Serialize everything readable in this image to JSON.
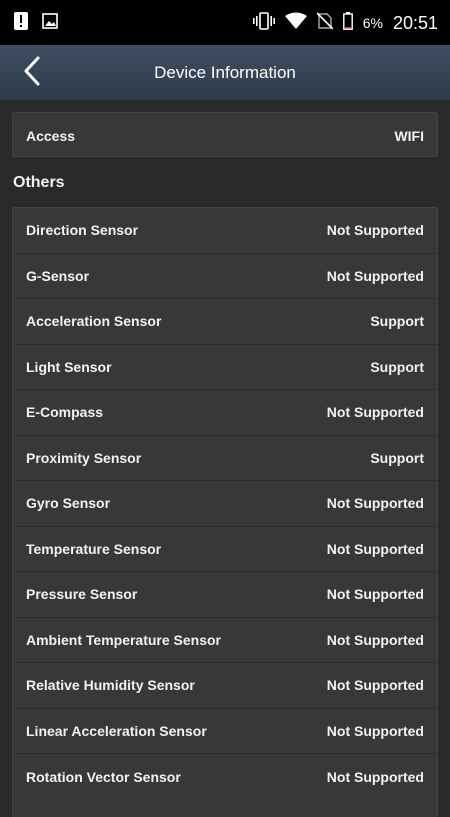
{
  "statusbar": {
    "time": "20:51",
    "battery_percent": "6%",
    "icons": [
      "alert-icon",
      "image-icon",
      "vibrate-icon",
      "wifi-icon",
      "no-sim-icon",
      "battery-icon"
    ]
  },
  "appbar": {
    "title": "Device Information",
    "back_icon": "chevron-left-icon"
  },
  "access": {
    "label": "Access",
    "value": "WIFI"
  },
  "others": {
    "title": "Others",
    "items": [
      {
        "label": "Direction Sensor",
        "value": "Not Supported"
      },
      {
        "label": "G-Sensor",
        "value": "Not Supported"
      },
      {
        "label": "Acceleration Sensor",
        "value": "Support"
      },
      {
        "label": "Light Sensor",
        "value": "Support"
      },
      {
        "label": "E-Compass",
        "value": "Not Supported"
      },
      {
        "label": "Proximity Sensor",
        "value": "Support"
      },
      {
        "label": "Gyro Sensor",
        "value": "Not Supported"
      },
      {
        "label": "Temperature Sensor",
        "value": "Not Supported"
      },
      {
        "label": "Pressure Sensor",
        "value": "Not Supported"
      },
      {
        "label": "Ambient Temperature Sensor",
        "value": "Not Supported"
      },
      {
        "label": "Relative Humidity Sensor",
        "value": "Not Supported"
      },
      {
        "label": "Linear Acceleration Sensor",
        "value": "Not Supported"
      },
      {
        "label": "Rotation Vector Sensor",
        "value": "Not Supported"
      }
    ]
  },
  "colors": {
    "background": "#2a2a2d",
    "card": "#38383b",
    "appbar_top": "#3f4e62",
    "appbar_bottom": "#2f3b4b",
    "text": "#f2f2f2"
  }
}
